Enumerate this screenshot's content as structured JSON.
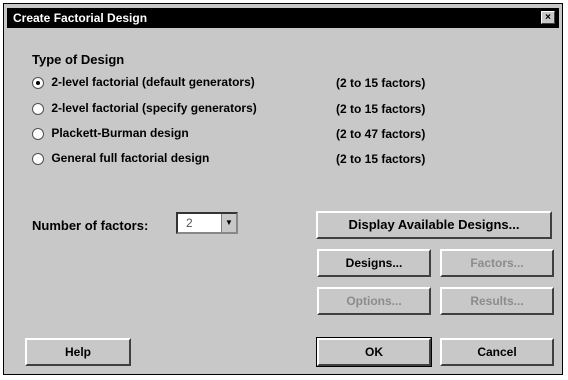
{
  "window": {
    "title": "Create Factorial Design",
    "close_glyph": "×"
  },
  "type_of_design": {
    "label": "Type of Design",
    "options": [
      {
        "label": "2-level factorial (default generators)",
        "range": "(2 to 15 factors)",
        "checked": true
      },
      {
        "label": "2-level factorial (specify generators)",
        "range": "(2 to 15 factors)",
        "checked": false
      },
      {
        "label": "Plackett-Burman design",
        "range": "(2 to 47 factors)",
        "checked": false
      },
      {
        "label": "General full factorial design",
        "range": "(2 to 15 factors)",
        "checked": false
      }
    ]
  },
  "number_of_factors": {
    "label": "Number of factors:",
    "value": "2"
  },
  "buttons": {
    "display_designs": "Display Available Designs...",
    "designs": "Designs...",
    "factors": "Factors...",
    "options": "Options...",
    "results": "Results...",
    "help": "Help",
    "ok": "OK",
    "cancel": "Cancel"
  }
}
